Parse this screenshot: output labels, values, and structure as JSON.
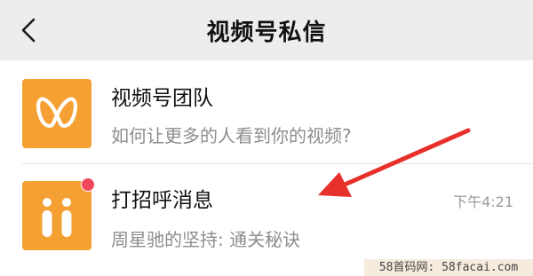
{
  "header": {
    "title": "视频号私信",
    "back_icon": "chevron-left-icon"
  },
  "conversations": [
    {
      "name": "视频号团队",
      "preview": "如何让更多的人看到你的视频?",
      "avatar_icon": "channels-logo-icon",
      "avatar_color": "#f5a033"
    },
    {
      "name": "打招呼消息",
      "preview": "周星驰的坚持: 通关秘诀",
      "time": "下午4:21",
      "avatar_icon": "people-pair-icon",
      "avatar_color": "#f5a033",
      "unread_badge": true,
      "badge_color": "#f0475a"
    }
  ],
  "annotation": {
    "type": "arrow",
    "color": "#e8302b"
  },
  "watermark": "58首码网: 58facai.com"
}
